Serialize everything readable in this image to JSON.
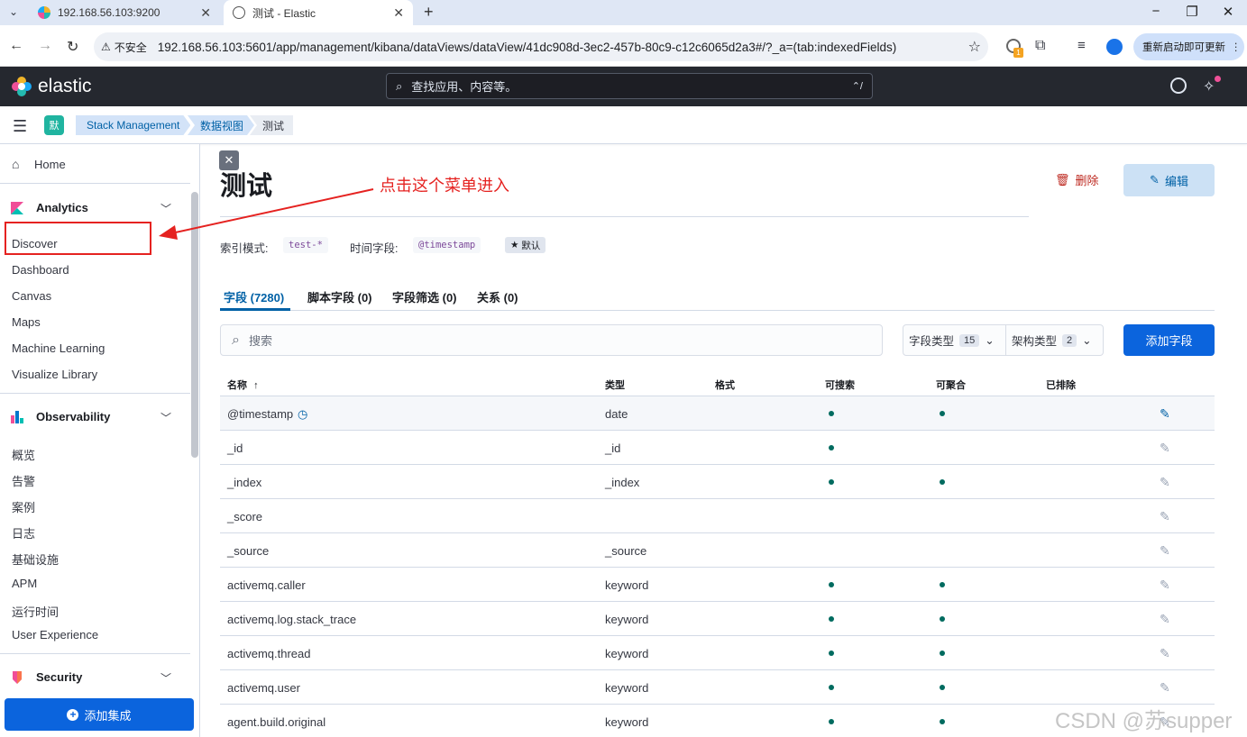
{
  "browser": {
    "tabs": [
      {
        "title": "192.168.56.103:9200"
      },
      {
        "title": "测试 - Elastic"
      }
    ],
    "security_label": "不安全",
    "url": "192.168.56.103:5601/app/management/kibana/dataViews/dataView/41dc908d-3ec2-457b-80c9-c12c6065d2a3#/?_a=(tab:indexedFields)",
    "update_button": "重新启动即可更新",
    "extension_badge": "1"
  },
  "header": {
    "brand": "elastic",
    "search_placeholder": "查找应用、内容等。",
    "search_shortcut": "⌃/"
  },
  "breadcrumbs": {
    "space_initial": "默",
    "items": [
      "Stack Management",
      "数据视图",
      "测试"
    ]
  },
  "sidebar": {
    "home": "Home",
    "sections": [
      {
        "title": "Analytics",
        "items": [
          "Discover",
          "Dashboard",
          "Canvas",
          "Maps",
          "Machine Learning",
          "Visualize Library"
        ]
      },
      {
        "title": "Observability",
        "items": [
          "概览",
          "告警",
          "案例",
          "日志",
          "基础设施",
          "APM",
          "运行时间",
          "User Experience"
        ]
      },
      {
        "title": "Security",
        "items": []
      }
    ],
    "add_integration": "添加集成"
  },
  "page": {
    "title": "测试",
    "delete_label": "删除",
    "edit_label": "编辑",
    "index_pattern_label": "索引模式:",
    "index_pattern_value": "test-*",
    "time_field_label": "时间字段:",
    "time_field_value": "@timestamp",
    "default_badge": "默认"
  },
  "tabs": [
    "字段 (7280)",
    "脚本字段 (0)",
    "字段筛选 (0)",
    "关系 (0)"
  ],
  "toolbar": {
    "search_placeholder": "搜索",
    "field_type_label": "字段类型",
    "field_type_count": "15",
    "schema_type_label": "架构类型",
    "schema_type_count": "2",
    "add_field": "添加字段"
  },
  "table": {
    "headers": [
      "名称",
      "类型",
      "格式",
      "可搜索",
      "可聚合",
      "已排除"
    ],
    "sort_indicator": "↑",
    "rows": [
      {
        "name": "@timestamp",
        "type": "date",
        "searchable": true,
        "aggregatable": true
      },
      {
        "name": "_id",
        "type": "_id",
        "searchable": true,
        "aggregatable": false
      },
      {
        "name": "_index",
        "type": "_index",
        "searchable": true,
        "aggregatable": true
      },
      {
        "name": "_score",
        "type": "",
        "searchable": false,
        "aggregatable": false
      },
      {
        "name": "_source",
        "type": "_source",
        "searchable": false,
        "aggregatable": false
      },
      {
        "name": "activemq.caller",
        "type": "keyword",
        "searchable": true,
        "aggregatable": true
      },
      {
        "name": "activemq.log.stack_trace",
        "type": "keyword",
        "searchable": true,
        "aggregatable": true
      },
      {
        "name": "activemq.thread",
        "type": "keyword",
        "searchable": true,
        "aggregatable": true
      },
      {
        "name": "activemq.user",
        "type": "keyword",
        "searchable": true,
        "aggregatable": true
      },
      {
        "name": "agent.build.original",
        "type": "keyword",
        "searchable": true,
        "aggregatable": true
      }
    ]
  },
  "annotation": {
    "text": "点击这个菜单进入"
  },
  "watermark": "CSDN @苏supper",
  "colors": {
    "accent": "#0b64dd",
    "annotation": "#e52220",
    "header_bg": "#25282f"
  }
}
